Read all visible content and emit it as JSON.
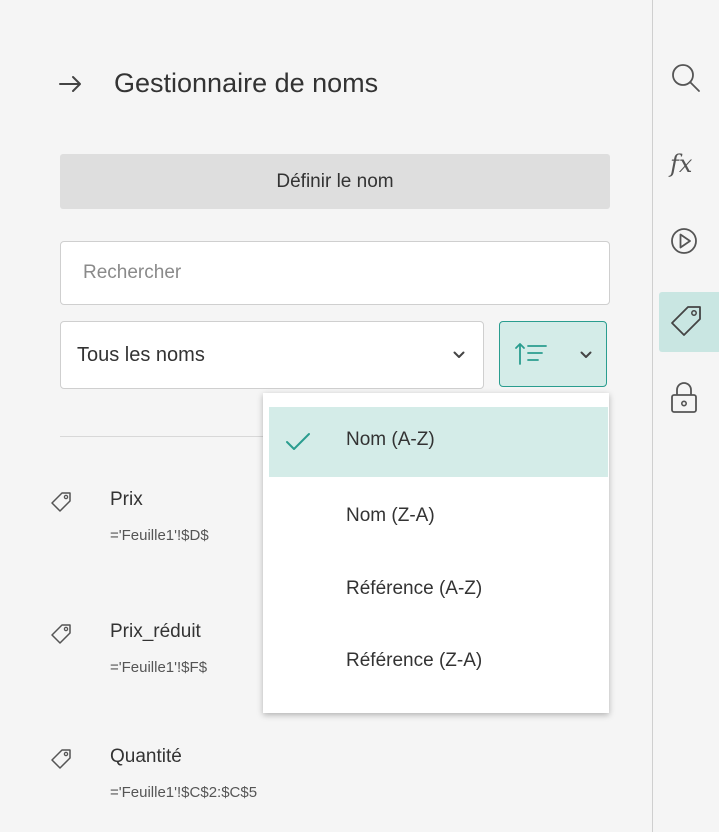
{
  "panel": {
    "title": "Gestionnaire de noms",
    "define_button": "Définir le nom",
    "search": {
      "placeholder": "Rechercher"
    },
    "filter": {
      "selected": "Tous les noms"
    }
  },
  "names": [
    {
      "label": "Prix",
      "ref": "='Feuille1'!$D$"
    },
    {
      "label": "Prix_réduit",
      "ref": "='Feuille1'!$F$"
    },
    {
      "label": "Quantité",
      "ref": "='Feuille1'!$C$2:$C$5"
    }
  ],
  "sort_menu": {
    "items": [
      {
        "label": "Nom (A-Z)",
        "selected": true
      },
      {
        "label": "Nom (Z-A)",
        "selected": false
      },
      {
        "label": "Référence (A-Z)",
        "selected": false
      },
      {
        "label": "Référence (Z-A)",
        "selected": false
      }
    ]
  },
  "rail": {
    "icons": [
      "search-icon",
      "function-icon",
      "play-icon",
      "tag-icon",
      "lock-icon"
    ],
    "active": "tag-icon"
  },
  "colors": {
    "accent": "#2a9d8f",
    "accent_bg": "#d4ece8"
  }
}
